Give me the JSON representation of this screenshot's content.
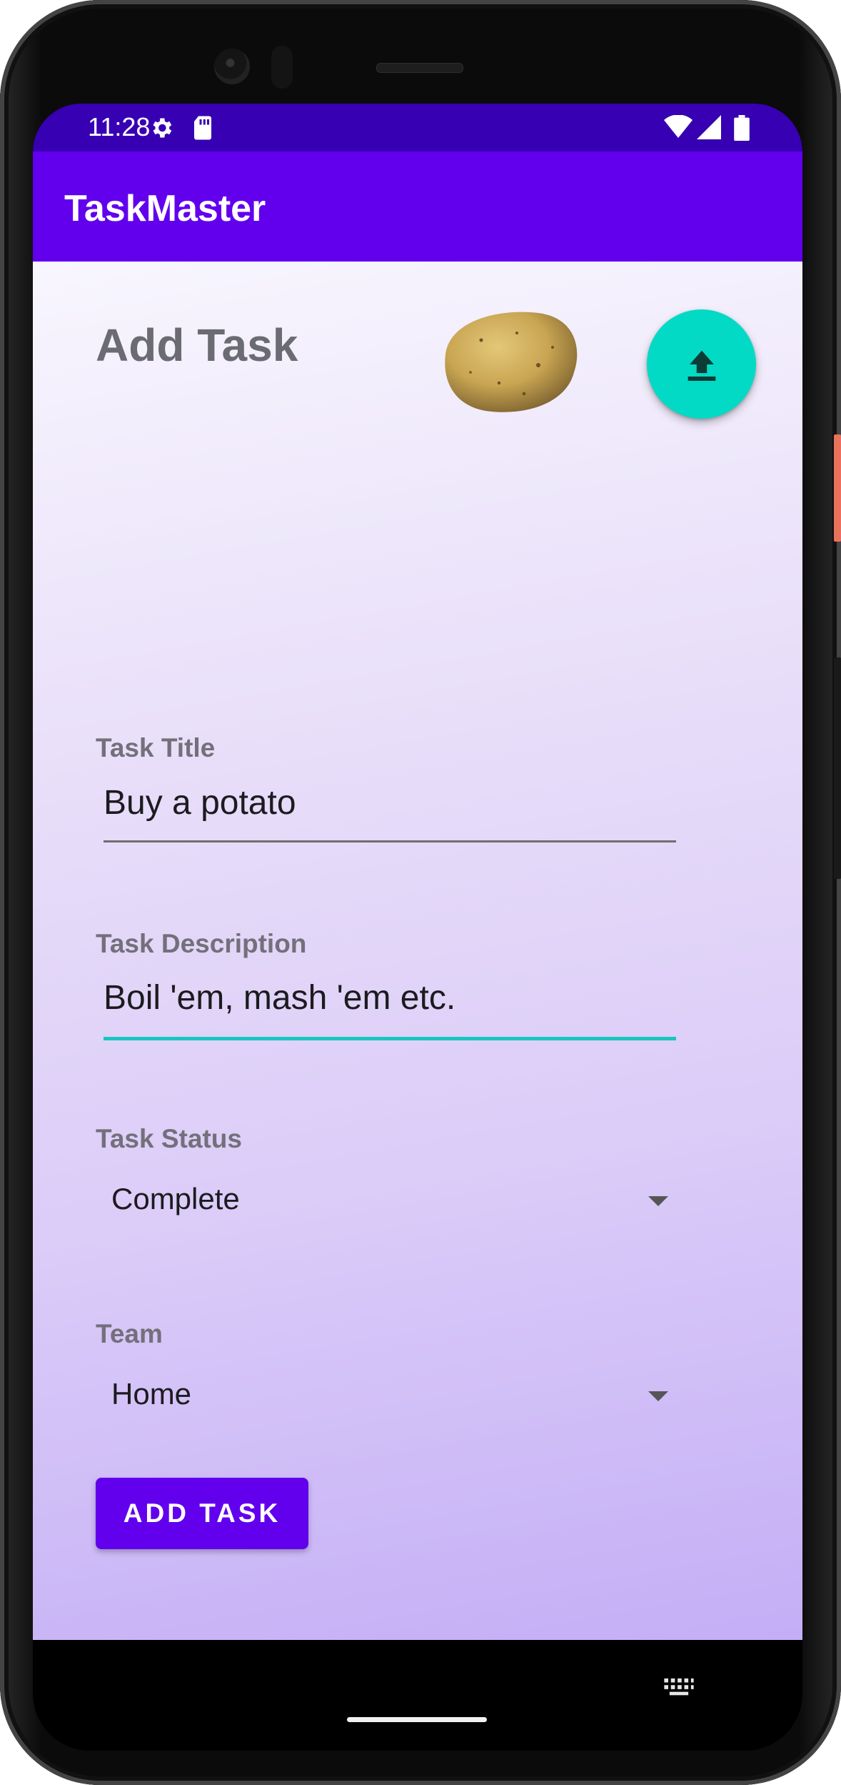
{
  "status_bar": {
    "time": "11:28",
    "left_icons": [
      "gear-icon",
      "sd-card-icon"
    ],
    "right_icons": [
      "wifi-icon",
      "signal-icon",
      "battery-icon"
    ],
    "background": "#3700b3"
  },
  "app_bar": {
    "title": "TaskMaster",
    "background": "#6200ee"
  },
  "page": {
    "title": "Add Task",
    "image": "potato-image",
    "fab_icon": "upload-icon",
    "fab_color": "#03dac5"
  },
  "form": {
    "task_title": {
      "label": "Task Title",
      "value": "Buy a potato"
    },
    "task_description": {
      "label": "Task Description",
      "value": "Boil 'em, mash 'em etc."
    },
    "task_status": {
      "label": "Task Status",
      "value": "Complete"
    },
    "team": {
      "label": "Team",
      "value": "Home"
    },
    "submit_label": "ADD TASK"
  },
  "nav_bar": {
    "icons": [
      "home-pill",
      "keyboard-icon"
    ]
  },
  "colors": {
    "accent": "#6200ee",
    "focus_underline": "#19c6bf"
  }
}
